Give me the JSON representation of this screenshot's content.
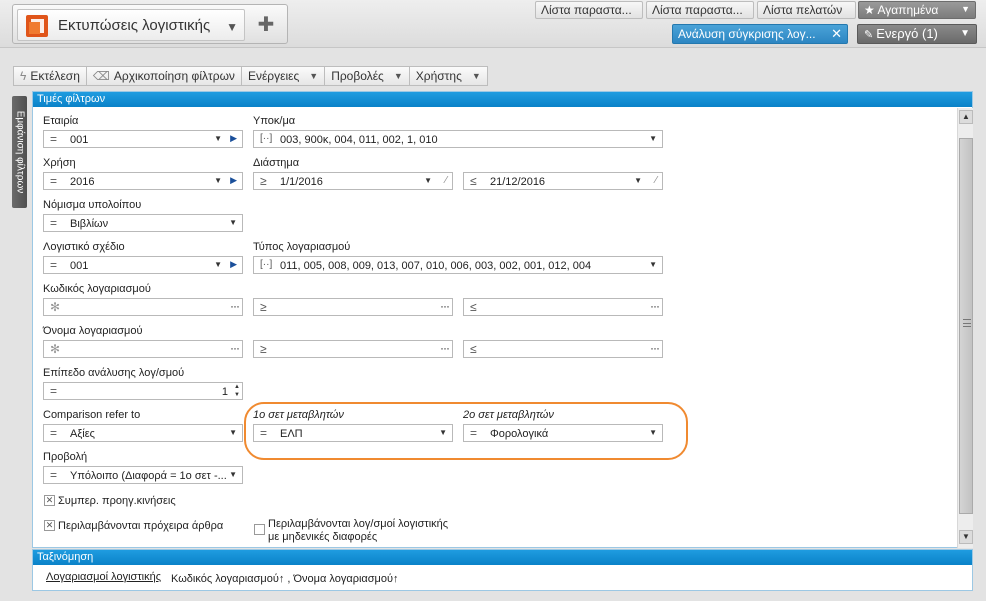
{
  "app": {
    "title": "Εκτυπώσεις λογιστικής"
  },
  "nav_tabs": [
    "Λίστα παραστα...",
    "Λίστα παραστα...",
    "Λίστα πελατών",
    "Αγαπημένα"
  ],
  "active_document": "Ανάλυση σύγκρισης λογ...",
  "active_button": "Ενεργό (1)",
  "toolbar": {
    "execute": "Εκτέλεση",
    "reset_filters": "Αρχικοποίηση φίλτρων",
    "actions": "Ενέργειες",
    "views": "Προβολές",
    "user": "Χρήστης"
  },
  "side_tab": "Εμφάνιση φίλτρων",
  "filter_panel": {
    "title": "Τιμές φίλτρων",
    "company": {
      "label": "Εταιρία",
      "value": "001"
    },
    "branch": {
      "label": "Υποκ/μα",
      "value": "003, 900κ, 004, 011, 002, 1, 010"
    },
    "fiscal_year": {
      "label": "Χρήση",
      "value": "2016"
    },
    "period": {
      "label": "Διάστημα",
      "from": "1/1/2016",
      "to": "21/12/2016"
    },
    "balance_currency": {
      "label": "Νόμισμα υπολοίπου",
      "value": "Βιβλίων"
    },
    "chart_of_accounts": {
      "label": "Λογιστικό σχέδιο",
      "value": "001"
    },
    "account_type": {
      "label": "Τύπος λογαριασμού",
      "value": "011, 005, 008, 009, 013, 007, 010, 006, 003, 002, 001, 012, 004"
    },
    "account_code": {
      "label": "Κωδικός λογαριασμού"
    },
    "account_name": {
      "label": "Όνομα λογαριασμού"
    },
    "analysis_level": {
      "label": "Επίπεδο ανάλυσης λογ/σμού",
      "value": "1"
    },
    "comparison": {
      "label": "Comparison refer to",
      "value": "Αξίες"
    },
    "var_set_1": {
      "label": "1ο σετ μεταβλητών",
      "value": "ΕΛΠ"
    },
    "var_set_2": {
      "label": "2ο σετ μεταβλητών",
      "value": "Φορολογικά"
    },
    "view": {
      "label": "Προβολή",
      "value": "Υπόλοιπο (Διαφορά = 1ο σετ -..."
    },
    "include_prev_moves": {
      "label": "Συμπερ. προηγ.κινήσεις",
      "checked": true
    },
    "include_drafts": {
      "label": "Περιλαμβάνονται πρόχειρα άρθρα",
      "checked": true
    },
    "include_zero_diff": {
      "label_line1": "Περιλαμβάνονται λογ/σμοί λογιστικής",
      "label_line2": "με μηδενικές διαφορές",
      "checked": false
    }
  },
  "sort_panel": {
    "title": "Ταξινόμηση",
    "link": "Λογαριασμοί λογιστικής",
    "fields": "Κωδικός λογαριασμού↑ , Όνομα λογαριασμού↑"
  },
  "colors": {
    "accent": "#0a82c8",
    "highlight": "#f08a30",
    "active_doc": "#2d86c2"
  }
}
